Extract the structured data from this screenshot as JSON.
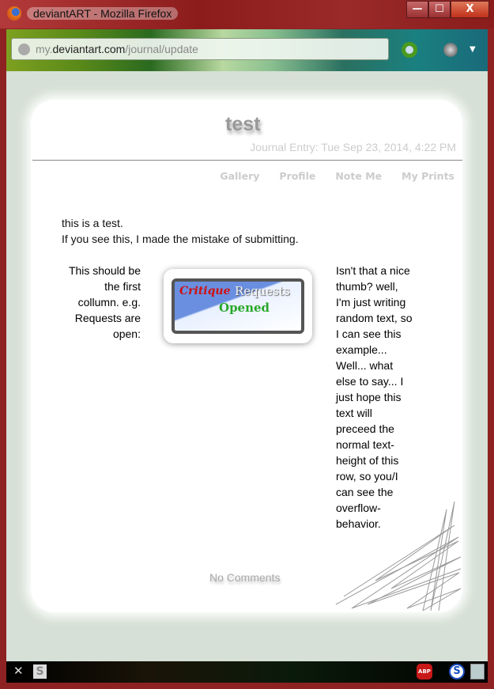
{
  "window": {
    "title": "deviantART - Mozilla Firefox",
    "minimize": "—",
    "maximize": "☐",
    "close": "X"
  },
  "address": {
    "prefix": "my.",
    "domain": "deviantart.com",
    "path": "/journal/update"
  },
  "journal": {
    "title": "test",
    "date": "Journal Entry: Tue Sep 23, 2014, 4:22 PM",
    "nav": [
      "Gallery",
      "Profile",
      "Note Me",
      "My Prints"
    ],
    "intro": [
      "this is a test.",
      "If you see this, I made the mistake of submitting."
    ],
    "col1": "This should be the first collumn. e.g. Requests are open:",
    "thumb": {
      "word1": "Critique",
      "word2": "Requests",
      "word3": "Opened"
    },
    "col3": "Isn't that a nice thumb? well, I'm just writing random text, so I can see this example... Well... what else to say... I just hope this text will preceed the normal text-height of this row, so you/I can see the overflow-behavior.",
    "comments": "No Comments"
  },
  "statusbar": {
    "close": "✕",
    "s_addon": "S",
    "abp": "ABP",
    "s_blue": "S"
  }
}
